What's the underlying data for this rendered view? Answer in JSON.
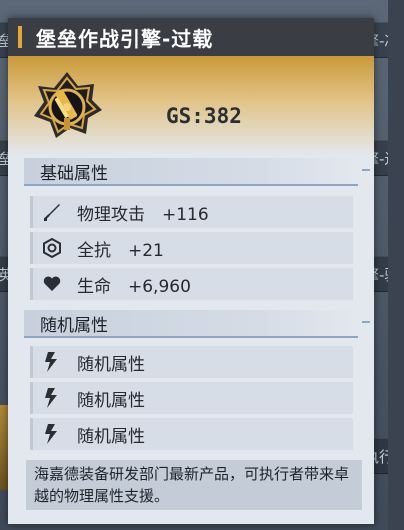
{
  "background": {
    "rows": [
      {
        "text_left": "垒",
        "text_right": "擎-凝"
      },
      {
        "text_left": "垒",
        "text_right": "擎-过"
      },
      {
        "text_left": "英",
        "text_right": "擎-驱"
      },
      {
        "text_left": "",
        "text_right": "执行者"
      }
    ]
  },
  "tooltip": {
    "title": "堡垒作战引擎-过载",
    "gs": "GS:382",
    "base_section": {
      "label": "基础属性",
      "stats": [
        {
          "icon": "sword-icon",
          "text": "物理攻击　+116"
        },
        {
          "icon": "hexagon-shield-icon",
          "text": "全抗　+21"
        },
        {
          "icon": "heart-icon",
          "text": "生命　+6,960"
        }
      ]
    },
    "random_section": {
      "label": "随机属性",
      "stats": [
        {
          "icon": "lightning-icon",
          "text": "随机属性"
        },
        {
          "icon": "lightning-icon",
          "text": "随机属性"
        },
        {
          "icon": "lightning-icon",
          "text": "随机属性"
        }
      ]
    },
    "description": "海嘉德装备研发部门最新产品，可执行者带来卓越的物理属性支援。"
  },
  "colors": {
    "accent": "#e0a83a",
    "title_bg": "#3a3d44",
    "panel_bg": "#e3e8ef",
    "section_line": "#8fa5c3"
  }
}
